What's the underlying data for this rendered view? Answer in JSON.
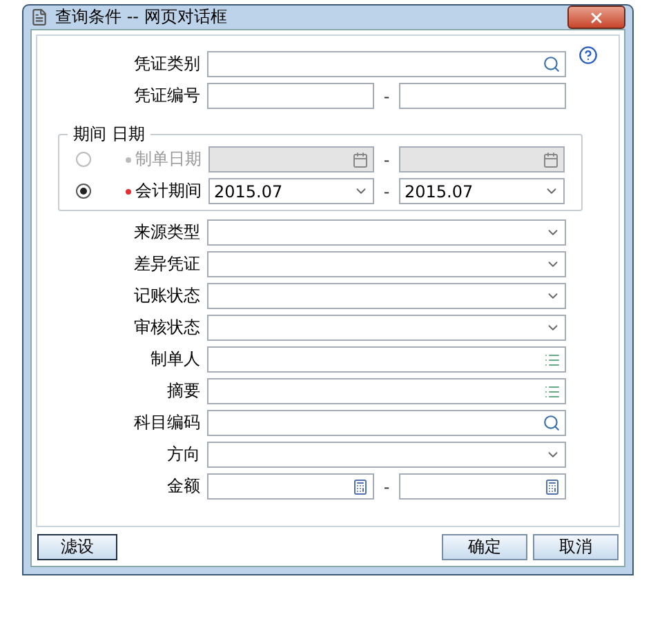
{
  "window": {
    "title": "查询条件 -- 网页对话框"
  },
  "top_fields": [
    {
      "label": "凭证类别",
      "kind": "search"
    },
    {
      "label": "凭证编号",
      "kind": "text_range",
      "separator": "-"
    }
  ],
  "period_group": {
    "legend": "期间 日期",
    "options": [
      {
        "label": "制单日期",
        "kind": "date_range",
        "selected": false,
        "disabled": true,
        "separator": "-"
      },
      {
        "label": "会计期间",
        "kind": "select_range",
        "selected": true,
        "disabled": false,
        "from": "2015.07",
        "to": "2015.07",
        "separator": "-"
      }
    ]
  },
  "fields": [
    {
      "label": "来源类型",
      "kind": "select"
    },
    {
      "label": "差异凭证",
      "kind": "select"
    },
    {
      "label": "记账状态",
      "kind": "select"
    },
    {
      "label": "审核状态",
      "kind": "select"
    },
    {
      "label": "制单人",
      "kind": "picker"
    },
    {
      "label": "摘要",
      "kind": "picker"
    },
    {
      "label": "科目编码",
      "kind": "search"
    },
    {
      "label": "方向",
      "kind": "select"
    },
    {
      "label": "金额",
      "kind": "amount_range",
      "separator": "-"
    }
  ],
  "buttons": {
    "left": [
      "滤设"
    ],
    "right": [
      "确定",
      "取消"
    ]
  }
}
